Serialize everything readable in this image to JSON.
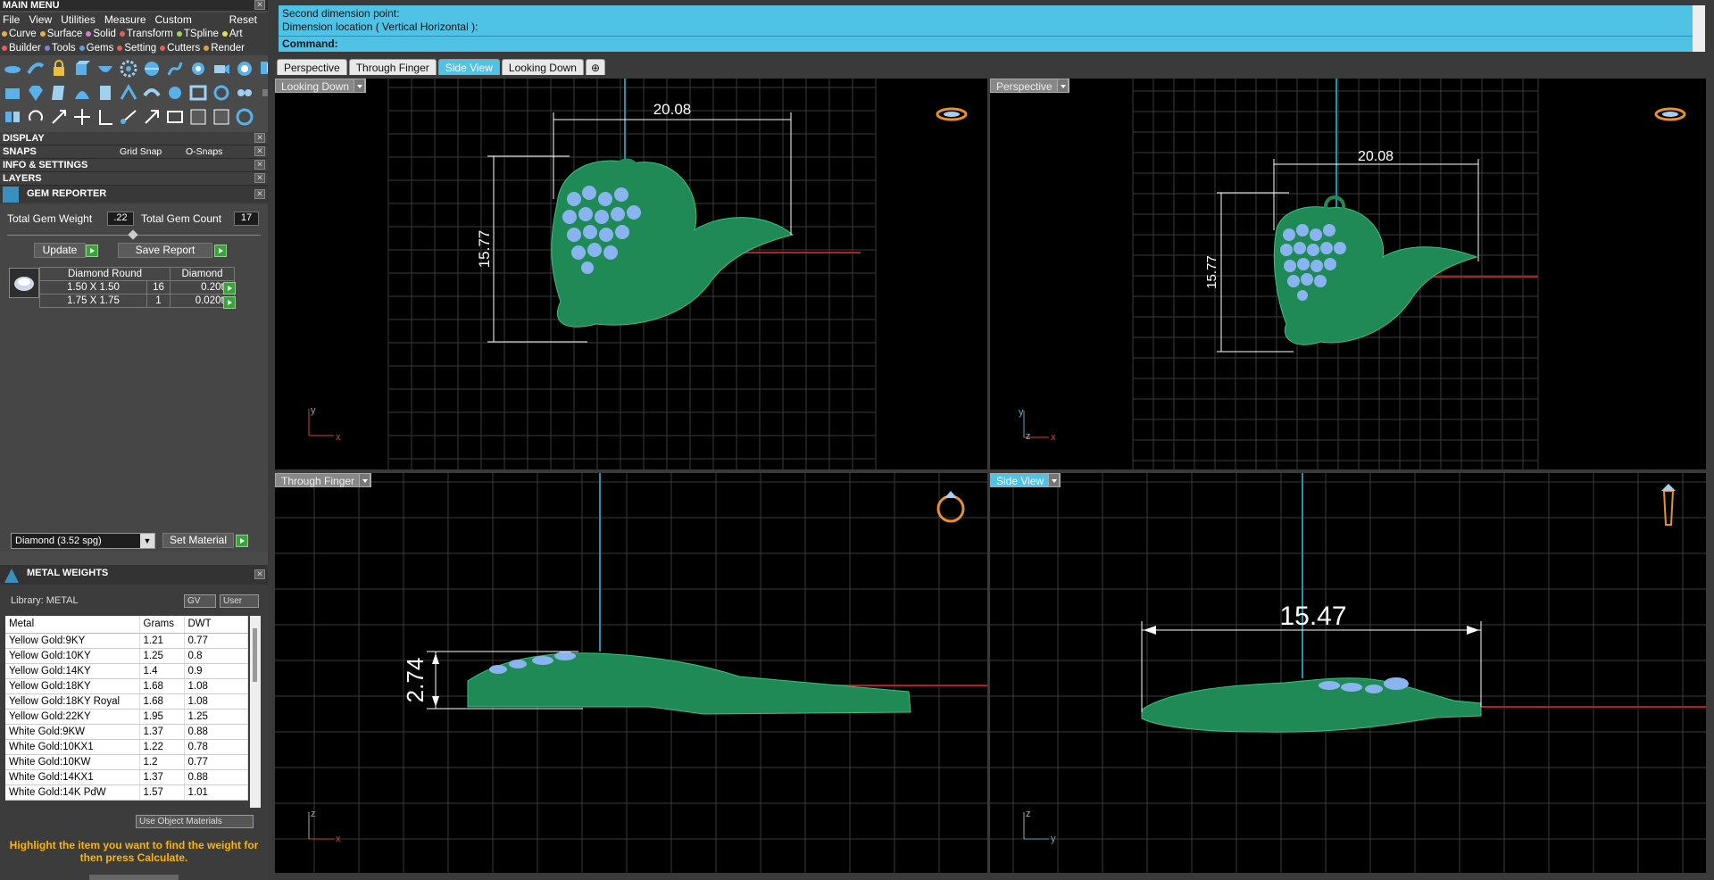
{
  "main_menu": {
    "title": "MAIN MENU",
    "menu_items": [
      "File",
      "View",
      "Utilities",
      "Measure",
      "Custom"
    ],
    "reset_label": "Reset",
    "categories_row1": [
      {
        "label": "Curve",
        "color": "#e8b040"
      },
      {
        "label": "Surface",
        "color": "#e8b040"
      },
      {
        "label": "Solid",
        "color": "#d080d0"
      },
      {
        "label": "Transform",
        "color": "#e06060"
      },
      {
        "label": "TSpline",
        "color": "#a0d060"
      },
      {
        "label": "Art",
        "color": "#e0e060"
      }
    ],
    "categories_row2": [
      {
        "label": "Builder",
        "color": "#e06060"
      },
      {
        "label": "Tools",
        "color": "#8080e0"
      },
      {
        "label": "Gems",
        "color": "#60a0e0"
      },
      {
        "label": "Setting",
        "color": "#e06060"
      },
      {
        "label": "Cutters",
        "color": "#e06060"
      },
      {
        "label": "Render",
        "color": "#e0a040"
      }
    ]
  },
  "sections": {
    "display": "DISPLAY",
    "snaps": "SNAPS",
    "grid_snap": "Grid Snap",
    "o_snaps": "O-Snaps",
    "info_settings": "INFO & SETTINGS",
    "layers": "LAYERS"
  },
  "gem_reporter": {
    "title": "GEM REPORTER",
    "total_weight_label": "Total Gem Weight",
    "total_weight_value": ".22",
    "total_count_label": "Total Gem Count",
    "total_count_value": "17",
    "update_label": "Update",
    "save_report_label": "Save Report",
    "table_headers": [
      "Diamond Round",
      "Diamond"
    ],
    "rows": [
      {
        "size": "1.50 X 1.50",
        "count": "16",
        "weight": "0.20tw"
      },
      {
        "size": "1.75 X 1.75",
        "count": "1",
        "weight": "0.020tw"
      }
    ],
    "material_select": "Diamond    (3.52 spg)",
    "set_material_label": "Set Material"
  },
  "metal_weights": {
    "title": "METAL WEIGHTS",
    "library_label": "Library: METAL",
    "gv_label": "GV",
    "user_label": "User",
    "headers": [
      "Metal",
      "Grams",
      "DWT"
    ],
    "rows": [
      {
        "metal": "Yellow Gold:9KY",
        "grams": "1.21",
        "dwt": "0.77"
      },
      {
        "metal": "Yellow Gold:10KY",
        "grams": "1.25",
        "dwt": "0.8"
      },
      {
        "metal": "Yellow Gold:14KY",
        "grams": "1.4",
        "dwt": "0.9"
      },
      {
        "metal": "Yellow Gold:18KY",
        "grams": "1.68",
        "dwt": "1.08"
      },
      {
        "metal": "Yellow Gold:18KY Royal",
        "grams": "1.68",
        "dwt": "1.08"
      },
      {
        "metal": "Yellow Gold:22KY",
        "grams": "1.95",
        "dwt": "1.25"
      },
      {
        "metal": "White Gold:9KW",
        "grams": "1.37",
        "dwt": "0.88"
      },
      {
        "metal": "White Gold:10KX1",
        "grams": "1.22",
        "dwt": "0.78"
      },
      {
        "metal": "White Gold:10KW",
        "grams": "1.2",
        "dwt": "0.77"
      },
      {
        "metal": "White Gold:14KX1",
        "grams": "1.37",
        "dwt": "0.88"
      },
      {
        "metal": "White Gold:14K PdW",
        "grams": "1.57",
        "dwt": "1.01"
      }
    ],
    "use_object_materials": "Use Object Materials",
    "hint": "Highlight the item you want to find the weight for then press Calculate."
  },
  "command": {
    "line1": "Second dimension point:",
    "line2": "Dimension location ( Vertical  Horizontal ):",
    "line3": "Command:"
  },
  "tabs": [
    "Perspective",
    "Through Finger",
    "Side View",
    "Looking Down"
  ],
  "active_tab": "Side View",
  "viewports": {
    "top_left": {
      "label": "Looking Down",
      "dim_h": "20.08",
      "dim_v": "15.77"
    },
    "top_right": {
      "label": "Perspective",
      "dim_h": "20.08",
      "dim_v": "15.77"
    },
    "bottom_left": {
      "label": "Through Finger",
      "dim_v": "2.74"
    },
    "bottom_right": {
      "label": "Side View",
      "dim_h": "15.47"
    }
  },
  "axis_labels": {
    "x": "x",
    "y": "y",
    "z": "z"
  },
  "colors": {
    "accent": "#4fc2e6",
    "model": "#1f8a55",
    "gem": "#8ab4f0",
    "dimension": "#ffffff"
  }
}
